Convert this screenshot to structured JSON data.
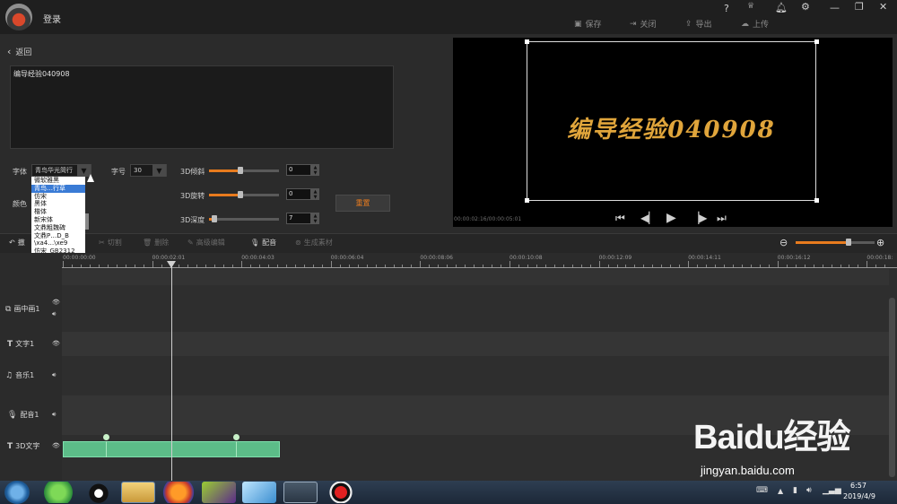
{
  "titlebar": {
    "login": "登录",
    "save": "保存",
    "close": "关闭",
    "export": "导出",
    "upload": "上传",
    "help": "?"
  },
  "left": {
    "back": "返回",
    "text_value": "编导经验040908",
    "font_label": "字体",
    "font_value": "青鸟华光简行",
    "size_label": "字号",
    "size_value": "30",
    "color_label": "颜色",
    "tilt_label": "3D倾斜",
    "tilt_value": "0",
    "tilt_level": 0.45,
    "rotate_label": "3D旋转",
    "rotate_value": "0",
    "rotate_level": 0.45,
    "depth_label": "3D深度",
    "depth_value": "7",
    "depth_level": 0.08,
    "reset_label": "重置",
    "font_options": [
      "微软雅黑",
      "青鸟…行草",
      "仿宋",
      "黑体",
      "楷体",
      "新宋体",
      "文鼎粗魏碑",
      "文鼎P…D_B",
      "\\xa4…\\xe9",
      "仿宋_GB2312"
    ]
  },
  "preview": {
    "text": "编导经验040908",
    "timecode": "00:00:02:16/00:00:05:01"
  },
  "edit_toolbar": {
    "cut": "切割",
    "delete": "删除",
    "advanced": "高级编辑",
    "dub": "配音",
    "generate": "生成素材",
    "undo_partial": "撤"
  },
  "ruler": {
    "ticks": [
      "00:00:00:00",
      "00:00:02:01",
      "00:00:04:03",
      "00:00:06:04",
      "00:00:08:06",
      "00:00:10:08",
      "00:00:12:09",
      "00:00:14:11",
      "00:00:16:12",
      "00:00:18:"
    ]
  },
  "tracks": [
    {
      "label": "画中画1",
      "icon": "pip-icon"
    },
    {
      "label": "文字1",
      "icon": "text-icon"
    },
    {
      "label": "音乐1",
      "icon": "music-icon"
    },
    {
      "label": "配音1",
      "icon": "mic-icon"
    },
    {
      "label": "3D文字",
      "icon": "text-icon"
    }
  ],
  "taskbar": {
    "time": "6:57",
    "date": "2019/4/9"
  },
  "watermark": {
    "brand": "Baidu经验",
    "url": "jingyan.baidu.com"
  },
  "colors": {
    "accent": "#e87b1e",
    "clip": "#5cbc88",
    "preview_text": "#e0a53b"
  }
}
